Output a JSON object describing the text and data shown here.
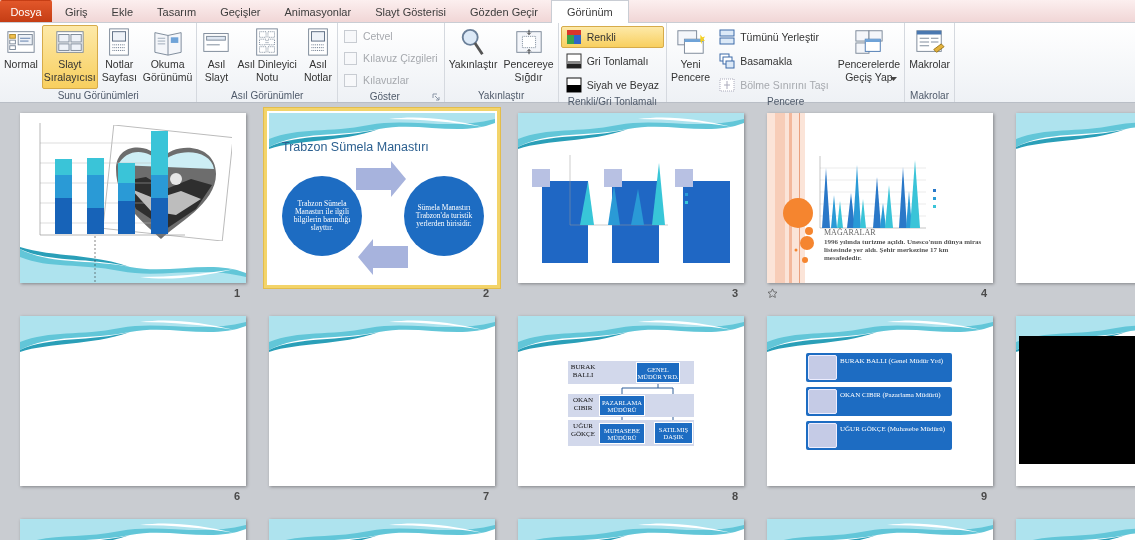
{
  "tabs": [
    {
      "label": "Dosya",
      "kind": "file",
      "selected": false
    },
    {
      "label": "Giriş",
      "kind": "tab",
      "selected": false
    },
    {
      "label": "Ekle",
      "kind": "tab",
      "selected": false
    },
    {
      "label": "Tasarım",
      "kind": "tab",
      "selected": false
    },
    {
      "label": "Geçişler",
      "kind": "tab",
      "selected": false
    },
    {
      "label": "Animasyonlar",
      "kind": "tab",
      "selected": false
    },
    {
      "label": "Slayt Gösterisi",
      "kind": "tab",
      "selected": false
    },
    {
      "label": "Gözden Geçir",
      "kind": "tab",
      "selected": false
    },
    {
      "label": "Görünüm",
      "kind": "tab",
      "selected": true
    }
  ],
  "ribbon_groups": [
    {
      "label": "Sunu Görünümleri",
      "items": [
        {
          "kind": "large",
          "label": "Normal",
          "selected": false
        },
        {
          "kind": "large",
          "label": "Slayt\nSıralayıcısı",
          "selected": true
        },
        {
          "kind": "large",
          "label": "Notlar\nSayfası",
          "selected": false
        },
        {
          "kind": "large",
          "label": "Okuma\nGörünümü",
          "selected": false
        }
      ]
    },
    {
      "label": "Asıl Görünümler",
      "items": [
        {
          "kind": "large",
          "label": "Asıl\nSlayt"
        },
        {
          "kind": "large",
          "label": "Asıl Dinleyici\nNotu"
        },
        {
          "kind": "large",
          "label": "Asıl\nNotlar"
        }
      ]
    },
    {
      "label": "Göster",
      "launcher": true,
      "items": [
        {
          "kind": "check",
          "label": "Cetvel",
          "checked": false,
          "disabled": true
        },
        {
          "kind": "check",
          "label": "Kılavuz Çizgileri",
          "checked": false,
          "disabled": true
        },
        {
          "kind": "check",
          "label": "Kılavuzlar",
          "checked": false,
          "disabled": true
        }
      ]
    },
    {
      "label": "Yakınlaştır",
      "items": [
        {
          "kind": "large",
          "label": "Yakınlaştır"
        },
        {
          "kind": "large",
          "label": "Pencereye\nSığdır"
        }
      ]
    },
    {
      "label": "Renkli/Gri Tonlamalı",
      "items": [
        {
          "kind": "small",
          "label": "Renkli",
          "selected": true
        },
        {
          "kind": "small",
          "label": "Gri Tonlamalı",
          "selected": false
        },
        {
          "kind": "small",
          "label": "Siyah ve Beyaz",
          "selected": false
        }
      ]
    },
    {
      "label": "Pencere",
      "items": [
        {
          "kind": "large",
          "label": "Yeni\nPencere"
        },
        {
          "kind": "small",
          "label": "Tümünü Yerleştir",
          "disabled": false
        },
        {
          "kind": "small",
          "label": "Basamakla",
          "disabled": false
        },
        {
          "kind": "small",
          "label": "Bölme Sınırını Taşı",
          "disabled": true
        },
        {
          "kind": "large",
          "label": "Pencerelerde\nGeçiş Yap",
          "dropdown": true
        }
      ]
    },
    {
      "label": "Makrolar",
      "items": [
        {
          "kind": "large",
          "label": "Makrolar"
        }
      ]
    }
  ],
  "slides": [
    {
      "number": "1",
      "selected": false,
      "animated": false,
      "kind": "wave-bottom",
      "content": {
        "kind": "chart-picture"
      }
    },
    {
      "number": "2",
      "selected": true,
      "animated": false,
      "kind": "wave",
      "content": {
        "kind": "cycle",
        "title": "Trabzon Sümela Manastırı",
        "circles": [
          "Trabzon Sümela Manastırı ile ilgili bilgilerin barındığı slayttır.",
          "Sümela Manastırı Trabzon'da turistik yerlerden birisidir."
        ]
      }
    },
    {
      "number": "3",
      "selected": false,
      "animated": false,
      "kind": "wave",
      "content": {
        "kind": "cone-chart"
      }
    },
    {
      "number": "4",
      "selected": false,
      "animated": true,
      "kind": "circles",
      "content": {
        "kind": "text-chart",
        "title": "MAĞARALAR",
        "body": "1996 yılında turizme açıldı. Unesco'nun dünya miras listesinde yer aldı. Şehir merkezine 17 km mesafededir."
      }
    },
    {
      "selected": false,
      "animated": false,
      "kind": "wave"
    },
    {
      "number": "6",
      "selected": false,
      "animated": false,
      "kind": "wave"
    },
    {
      "number": "7",
      "selected": false,
      "animated": false,
      "kind": "wave"
    },
    {
      "number": "8",
      "selected": false,
      "animated": false,
      "kind": "wave",
      "content": {
        "kind": "org",
        "rows": [
          {
            "name": "BURAK BALLI",
            "boxes": [
              "GENEL MÜDÜR YRD."
            ]
          },
          {
            "name": "OKAN CIBIR",
            "boxes": [
              "PAZARLAMA MÜDÜRÜ"
            ]
          },
          {
            "name": "UĞUR GÖKÇE",
            "boxes": [
              "MUHASEBE MÜDÜRÜ",
              "SATILMIŞ DAŞIK"
            ]
          }
        ]
      }
    },
    {
      "number": "9",
      "selected": false,
      "animated": false,
      "kind": "wave",
      "content": {
        "kind": "list",
        "items": [
          "BURAK BALLI  (Genel Müdür Yrd)",
          "OKAN CIBIR (Pazarlama Müdürü)",
          "UĞUR GÖKÇE (Muhasebe Müdürü)"
        ]
      }
    },
    {
      "selected": false,
      "animated": false,
      "kind": "wave",
      "content": {
        "kind": "video"
      }
    },
    {
      "selected": false,
      "kind": "wave"
    },
    {
      "selected": false,
      "kind": "wave"
    },
    {
      "selected": false,
      "kind": "wave"
    },
    {
      "selected": false,
      "kind": "wave"
    },
    {
      "selected": false,
      "kind": "wave"
    }
  ]
}
